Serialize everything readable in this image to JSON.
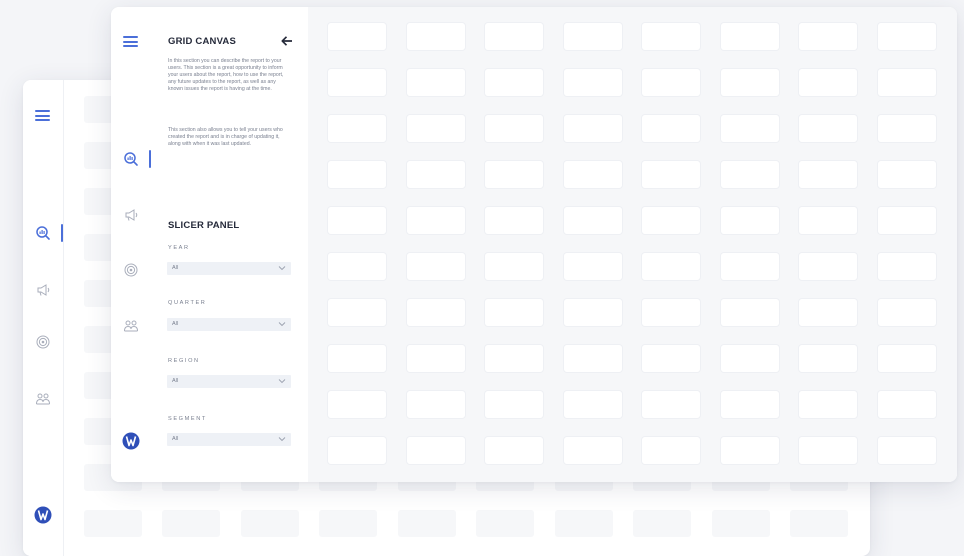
{
  "accent_color": "#4b6fd9",
  "grid_canvas": {
    "title": "GRID CANVAS",
    "back_icon": "arrow-left-icon",
    "paragraph1": "In this section you can describe the report to your users. This section is a great opportunity to inform your users about the report, how to use the report, any future updates to the report, as well as any known issues the report is having at the time.",
    "paragraph2": "This section also allows you to tell your users who created the report and is in charge of updating it, along with when it was last updated."
  },
  "slicer_panel": {
    "title": "SLICER PANEL",
    "fields": [
      {
        "label": "YEAR",
        "value": "All"
      },
      {
        "label": "QUARTER",
        "value": "All"
      },
      {
        "label": "REGION",
        "value": "All"
      },
      {
        "label": "SEGMENT",
        "value": "All"
      }
    ]
  },
  "rail_icons": [
    "menu-icon",
    "search-analytics-icon",
    "megaphone-icon",
    "target-icon",
    "people-icon",
    "brand-logo"
  ]
}
